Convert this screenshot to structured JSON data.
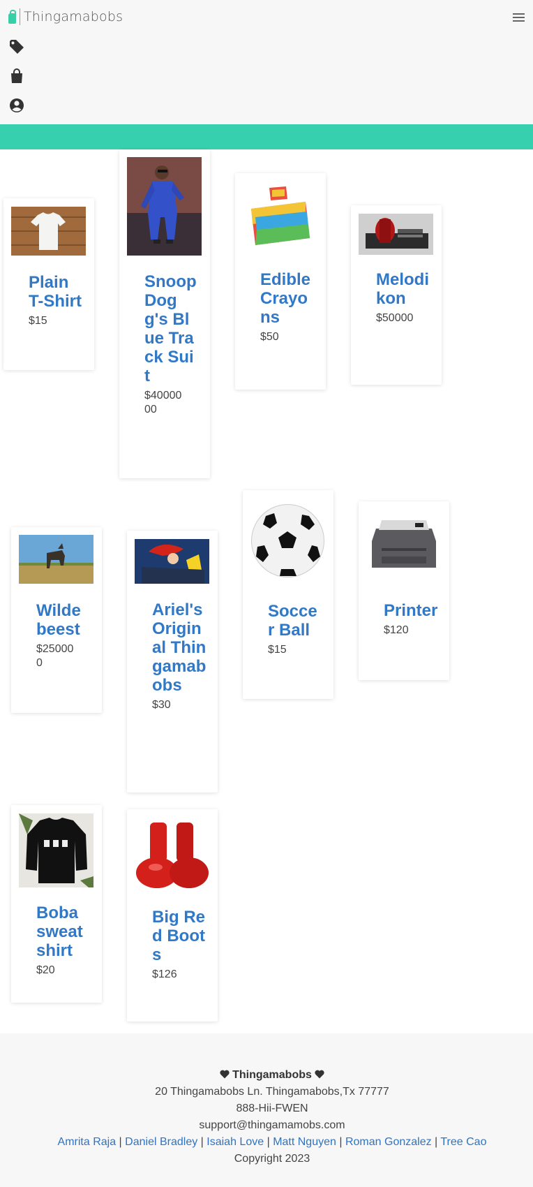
{
  "header": {
    "brand": "Thingamabobs",
    "menu_icon": "hamburger-menu-icon",
    "nav_icons": [
      "tag-icon",
      "shopping-bag-icon",
      "user-account-icon"
    ],
    "accent": "#37d0ae"
  },
  "products": [
    {
      "name": "Plain T-Shirt",
      "price": "$15",
      "image": "white-tshirt-image"
    },
    {
      "name": "Snoop Dogg's Blue Track Suit",
      "price": "$4000000",
      "image": "snoop-dogg-image"
    },
    {
      "name": "Edible Crayons",
      "price": "$50",
      "image": "crayons-box-image"
    },
    {
      "name": "Melodikon",
      "price": "$50000",
      "image": "melodikon-image"
    },
    {
      "name": "Wildebeest",
      "price": "$250000",
      "image": "wildebeest-image"
    },
    {
      "name": "Ariel's Original Thingamabobs",
      "price": "$30",
      "image": "ariel-image"
    },
    {
      "name": "Soccer Ball",
      "price": "$15",
      "image": "soccer-ball-image"
    },
    {
      "name": "Printer",
      "price": "$120",
      "image": "printer-image"
    },
    {
      "name": "Boba sweatshirt",
      "price": "$20",
      "image": "boba-sweatshirt-image"
    },
    {
      "name": "Big Red Boots",
      "price": "$126",
      "image": "red-boots-image"
    }
  ],
  "footer": {
    "title": "Thingamabobs",
    "address": "20 Thingamabobs Ln. Thingamabobs,Tx 77777",
    "phone": "888-Hii-FWEN",
    "email": "support@thingamamobs.com",
    "authors": [
      "Amrita Raja",
      "Daniel Bradley",
      "Isaiah Love",
      "Matt Nguyen",
      "Roman Gonzalez",
      "Tree Cao"
    ],
    "separator": "|",
    "copyright": "Copyright 2023"
  }
}
